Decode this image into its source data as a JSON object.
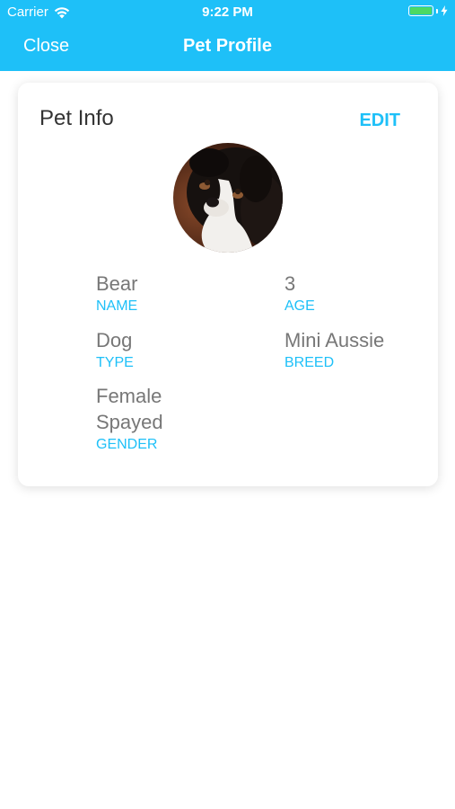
{
  "status_bar": {
    "carrier": "Carrier",
    "time": "9:22 PM",
    "battery_level": 1.0
  },
  "nav": {
    "close_label": "Close",
    "title": "Pet Profile"
  },
  "card": {
    "title": "Pet Info",
    "edit_label": "EDIT",
    "photo": "dog-photo",
    "fields": {
      "name": {
        "value": "Bear",
        "label": "NAME"
      },
      "age": {
        "value": "3",
        "label": "AGE"
      },
      "type": {
        "value": "Dog",
        "label": "TYPE"
      },
      "breed": {
        "value": "Mini Aussie",
        "label": "BREED"
      },
      "gender": {
        "value_line1": "Female",
        "value_line2": "Spayed",
        "label": "GENDER"
      }
    }
  },
  "colors": {
    "accent": "#1ec0f8",
    "value_text": "#777777",
    "title_text": "#333333",
    "battery": "#4cd964"
  },
  "icons": [
    "wifi-icon",
    "battery-icon",
    "charging-bolt-icon"
  ]
}
